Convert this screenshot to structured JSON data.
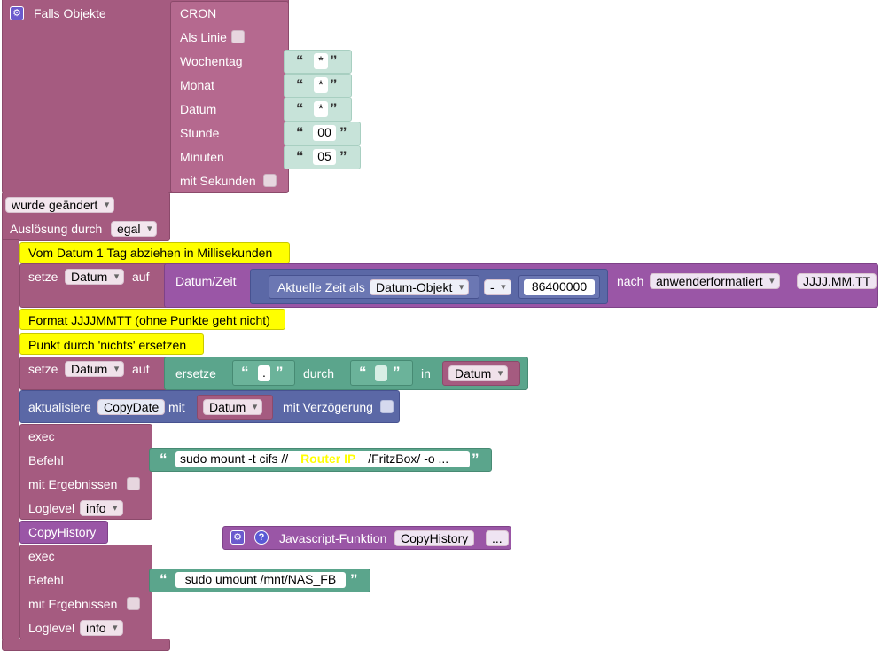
{
  "trigger": {
    "label": "Falls Objekte",
    "cron": "CRON",
    "als_linie": "Als Linie",
    "wochentag": "Wochentag",
    "wochentag_val": "*",
    "monat": "Monat",
    "monat_val": "*",
    "datum": "Datum",
    "datum_val": "*",
    "stunde": "Stunde",
    "stunde_val": "00",
    "minuten": "Minuten",
    "minuten_val": "05",
    "mit_sekunden": "mit Sekunden",
    "wurde_geaendert": "wurde geändert",
    "ausloesung": "Auslösung durch",
    "ausloesung_val": "egal"
  },
  "comment1": "Vom Datum 1 Tag abziehen in Millisekunden",
  "setze1": {
    "setze": "setze",
    "var": "Datum",
    "auf": "auf",
    "datum_zeit": "Datum/Zeit",
    "aktuelle_zeit": "Aktuelle Zeit als",
    "datum_objekt": "Datum-Objekt",
    "op": "-",
    "number": "86400000",
    "nach": "nach",
    "format_type": "anwenderformatiert",
    "format": "JJJJ.MM.TT"
  },
  "comment2": "Format JJJJMMTT (ohne Punkte geht nicht)",
  "comment3": "Punkt durch 'nichts' ersetzen",
  "setze2": {
    "setze": "setze",
    "var": "Datum",
    "auf": "auf",
    "ersetze": "ersetze",
    "search": ".",
    "durch": "durch",
    "in": "in",
    "in_var": "Datum"
  },
  "aktualisiere": {
    "label": "aktualisiere",
    "obj": "CopyDate",
    "mit": "mit",
    "var": "Datum",
    "verzoegerung": "mit Verzögerung"
  },
  "exec1": {
    "exec": "exec",
    "befehl": "Befehl",
    "cmd_a": "sudo mount -t cifs //",
    "cmd_router": "Router IP",
    "cmd_b": "/FritzBox/ -o ...",
    "mit_ergebnissen": "mit Ergebnissen",
    "loglevel": "Loglevel",
    "loglevel_val": "info"
  },
  "copyhistory": "CopyHistory",
  "js_func": {
    "label": "Javascript-Funktion",
    "name": "CopyHistory",
    "more": "..."
  },
  "exec2": {
    "exec": "exec",
    "befehl": "Befehl",
    "cmd": "sudo umount /mnt/NAS_FB",
    "mit_ergebnissen": "mit Ergebnissen",
    "loglevel": "Loglevel",
    "loglevel_val": "info"
  }
}
